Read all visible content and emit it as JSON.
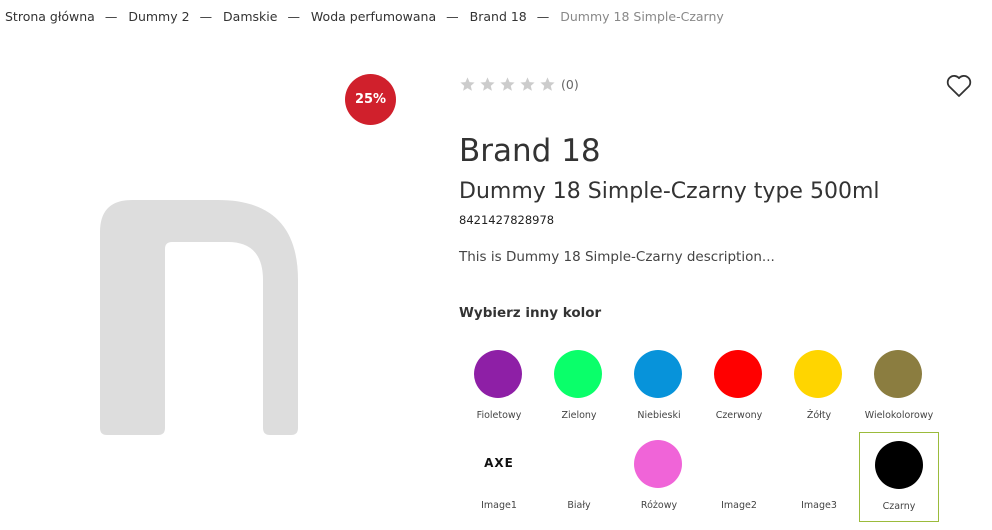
{
  "breadcrumb": [
    "Strona główna",
    "Dummy 2",
    "Damskie",
    "Woda perfumowana",
    "Brand 18",
    "Dummy 18 Simple-Czarny"
  ],
  "breadcrumb_separator": "—",
  "badge": {
    "discount": "25%"
  },
  "rating": {
    "stars_filled": 0,
    "stars_total": 5,
    "count": "(0)"
  },
  "product": {
    "brand": "Brand 18",
    "name": "Dummy 18 Simple-Czarny type 500ml",
    "ean": "8421427828978",
    "description": "This is Dummy 18 Simple-Czarny description..."
  },
  "colors": {
    "heading": "Wybierz inny kolor",
    "items": [
      {
        "label": "Fioletowy",
        "type": "dot",
        "color": "#8e1fa6"
      },
      {
        "label": "Zielony",
        "type": "dot",
        "color": "#0aff6a"
      },
      {
        "label": "Niebieski",
        "type": "dot",
        "color": "#0793da"
      },
      {
        "label": "Czerwony",
        "type": "dot",
        "color": "#ff0000"
      },
      {
        "label": "Żółty",
        "type": "dot",
        "color": "#ffd500"
      },
      {
        "label": "Wielokolorowy",
        "type": "dot",
        "color": "#8b7d40"
      },
      {
        "label": "Image1",
        "type": "logo",
        "logo_text": "AXE"
      },
      {
        "label": "Biały",
        "type": "dot",
        "color": "#ffffff"
      },
      {
        "label": "Różowy",
        "type": "dot",
        "color": "#f064d8"
      },
      {
        "label": "Image2",
        "type": "none"
      },
      {
        "label": "Image3",
        "type": "none"
      },
      {
        "label": "Czarny",
        "type": "dot",
        "color": "#000000",
        "selected": true
      }
    ]
  },
  "icons": {
    "star": "star-icon",
    "wishlist": "heart-icon",
    "placeholder": "image-placeholder-icon"
  },
  "theme": {
    "badge_color": "#d0202c",
    "star_empty_color": "#cccccc",
    "placeholder_color": "#dddddd",
    "selected_border": "#9bbb3b"
  }
}
